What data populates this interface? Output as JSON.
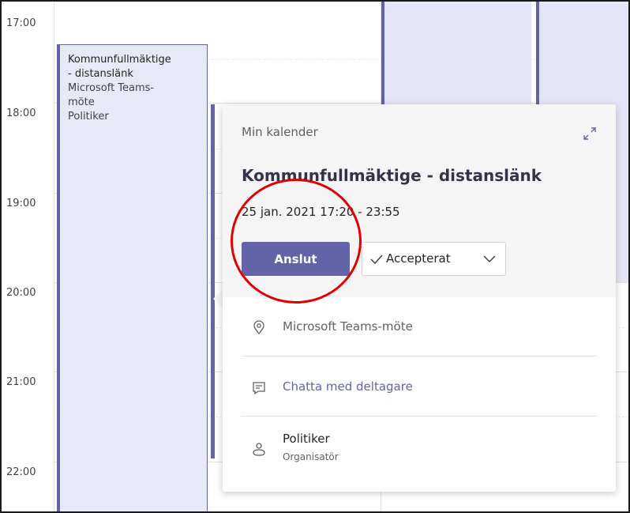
{
  "time_labels": [
    "17:00",
    "18:00",
    "19:00",
    "20:00",
    "21:00",
    "22:00"
  ],
  "event_card": {
    "title_line1": "Kommunfullmäktige",
    "title_line2": "- distanslänk",
    "location_line1": "Microsoft Teams-",
    "location_line2": "möte",
    "organizer": "Politiker"
  },
  "popup": {
    "calendar_label": "Min kalender",
    "title": "Kommunfullmäktige - distanslänk",
    "datetime": "25 jan. 2021 17:20 - 23:55",
    "join_label": "Anslut",
    "rsvp_label": "Accepterat",
    "location": "Microsoft Teams-möte",
    "chat_label": "Chatta med deltagare",
    "organizer_name": "Politiker",
    "organizer_role": "Organisatör"
  },
  "colors": {
    "accent": "#6264a7",
    "event_bg": "#e8e9f7",
    "annotation": "#e00000"
  }
}
